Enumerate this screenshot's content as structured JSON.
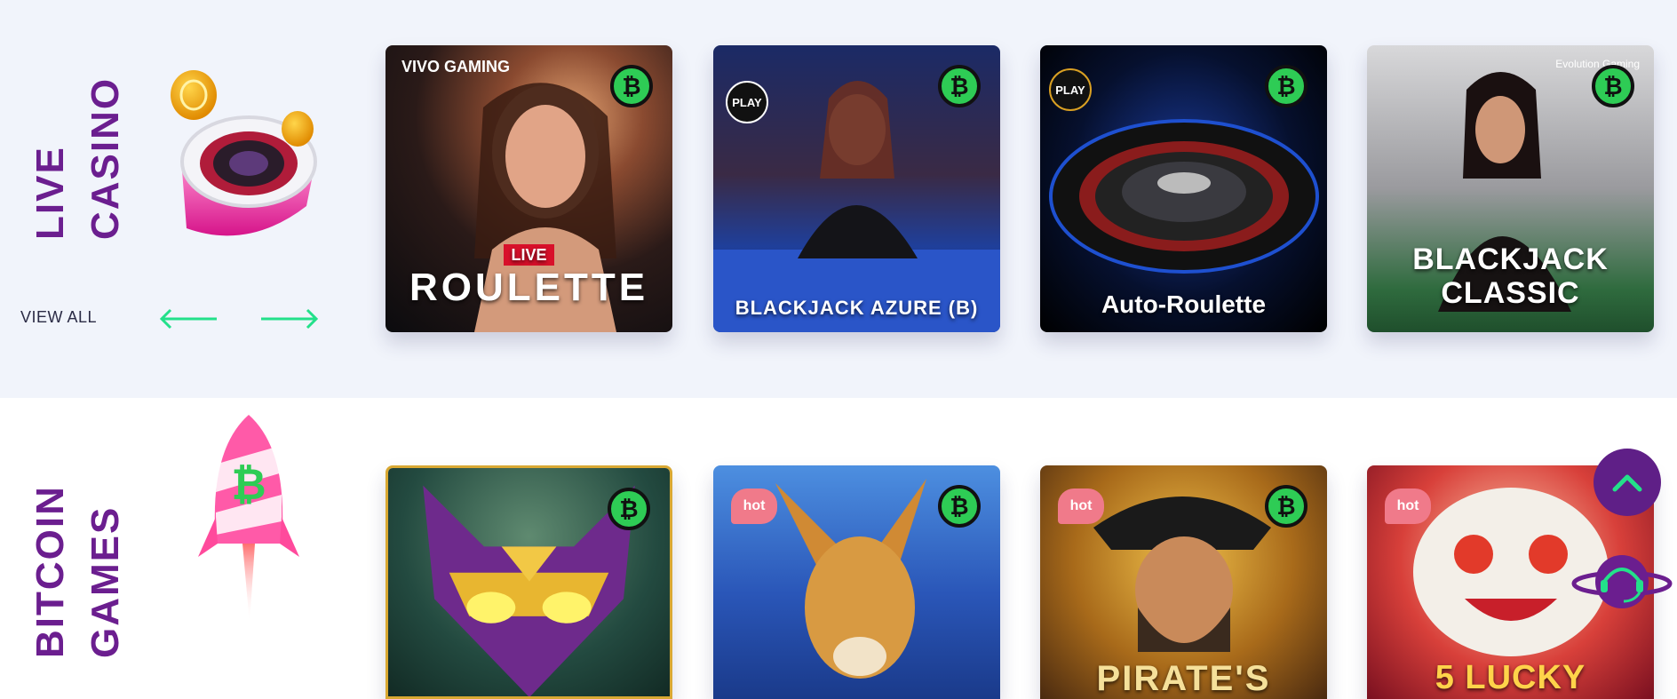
{
  "live_casino": {
    "title_line1": "LIVE",
    "title_line2": "CASINO",
    "view_all": "VIEW ALL",
    "games": [
      {
        "title_small": "LIVE",
        "title": "ROULETTE",
        "provider": "VIVO GAMING",
        "badge": "₿"
      },
      {
        "title": "BLACKJACK AZURE (B)",
        "provider": "PLAY",
        "badge": "₿"
      },
      {
        "title": "Auto-Roulette",
        "provider": "PLAY",
        "badge": "₿"
      },
      {
        "title_line1": "BLACKJACK",
        "title_line2": "CLASSIC",
        "provider": "Evolution Gaming",
        "badge": "₿"
      }
    ]
  },
  "bitcoin_games": {
    "title_line1": "BITCOIN",
    "title_line2": "GAMES",
    "games": [
      {
        "title": "",
        "hot": "",
        "badge": "₿"
      },
      {
        "title": "",
        "hot": "hot",
        "badge": "₿"
      },
      {
        "title": "PIRATE'S",
        "hot": "hot",
        "badge": "₿"
      },
      {
        "title": "5 LUCKY",
        "hot": "hot",
        "badge": ""
      }
    ]
  },
  "colors": {
    "accent_purple": "#6b1e8f",
    "accent_green": "#2ecc55",
    "arrow_green": "#23e08a",
    "hot_pink": "#f07a8a"
  },
  "icons": {
    "arrow_left": "arrow-left-icon",
    "arrow_right": "arrow-right-icon",
    "scroll_top": "chevron-up-icon",
    "support": "headset-support-icon"
  }
}
